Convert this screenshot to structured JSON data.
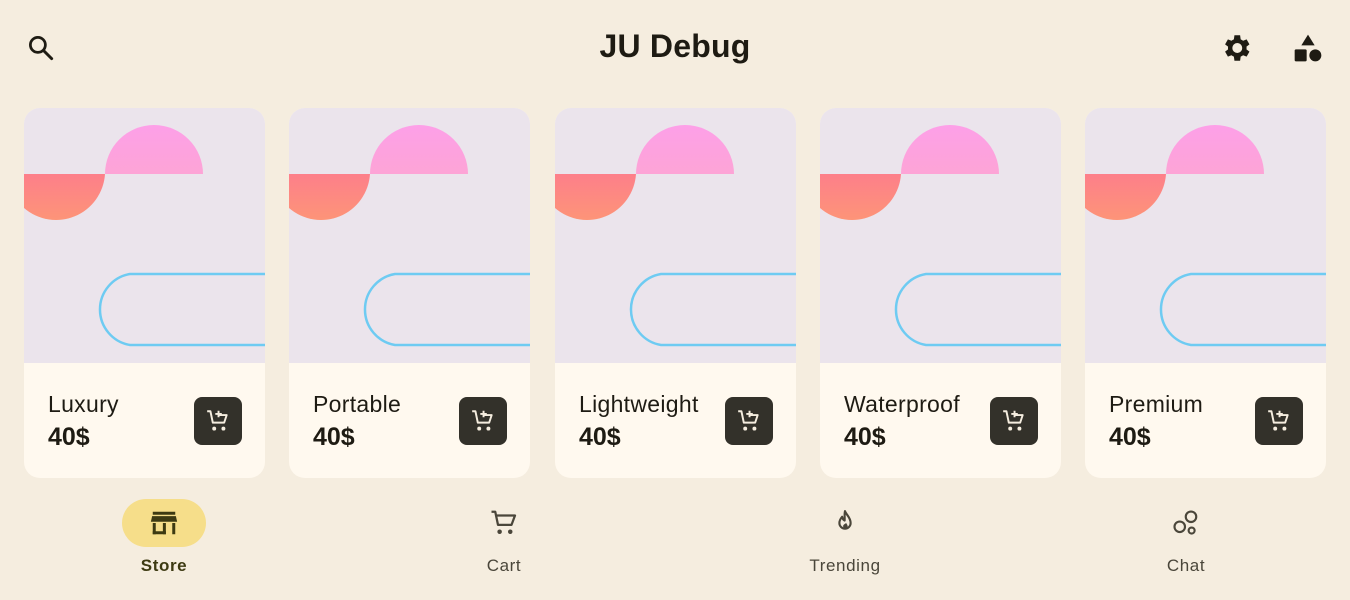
{
  "app": {
    "title": "JU Debug"
  },
  "topbar": {
    "search_icon": "search-icon",
    "settings_icon": "gear-icon",
    "shapes_icon": "shapes-icon"
  },
  "colors": {
    "background": "#f5eddf",
    "card_background": "#fff9ef",
    "card_image_background": "#ebe4ec",
    "cart_button": "#33312a",
    "active_nav_pill": "#f6de8a",
    "accent_pink": "#fda0e8",
    "accent_salmon": "#fd8a78",
    "accent_blue": "#6ecbf2"
  },
  "products": [
    {
      "name": "Luxury",
      "price": "40$"
    },
    {
      "name": "Portable",
      "price": "40$"
    },
    {
      "name": "Lightweight",
      "price": "40$"
    },
    {
      "name": "Waterproof",
      "price": "40$"
    },
    {
      "name": "Premium",
      "price": "40$"
    }
  ],
  "nav": {
    "items": [
      {
        "label": "Store",
        "icon": "store-icon",
        "active": true
      },
      {
        "label": "Cart",
        "icon": "cart-icon",
        "active": false
      },
      {
        "label": "Trending",
        "icon": "flame-icon",
        "active": false
      },
      {
        "label": "Chat",
        "icon": "chat-bubbles-icon",
        "active": false
      }
    ]
  }
}
